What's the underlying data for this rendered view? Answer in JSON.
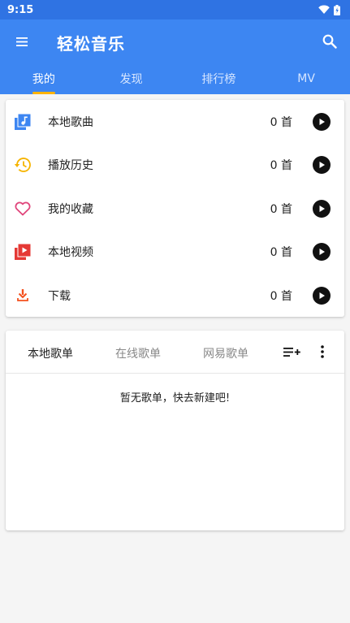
{
  "status": {
    "time": "9:15"
  },
  "app": {
    "title": "轻松音乐"
  },
  "tabs": [
    {
      "label": "我的"
    },
    {
      "label": "发现"
    },
    {
      "label": "排行榜"
    },
    {
      "label": "MV"
    }
  ],
  "library": [
    {
      "label": "本地歌曲",
      "count": "0 首",
      "icon": "music-library-icon",
      "color": "#3d86f2"
    },
    {
      "label": "播放历史",
      "count": "0 首",
      "icon": "history-icon",
      "color": "#f6b400"
    },
    {
      "label": "我的收藏",
      "count": "0 首",
      "icon": "heart-icon",
      "color": "#e0457b"
    },
    {
      "label": "本地视频",
      "count": "0 首",
      "icon": "video-library-icon",
      "color": "#e53935"
    },
    {
      "label": "下载",
      "count": "0 首",
      "icon": "download-icon",
      "color": "#f4511e"
    }
  ],
  "playlists": {
    "tabs": [
      {
        "label": "本地歌单"
      },
      {
        "label": "在线歌单"
      },
      {
        "label": "网易歌单"
      }
    ],
    "empty_text": "暂无歌单，快去新建吧!"
  },
  "colors": {
    "status_bar": "#2f73e3",
    "app_bar": "#3d86f2",
    "tab_indicator": "#ffb300"
  }
}
